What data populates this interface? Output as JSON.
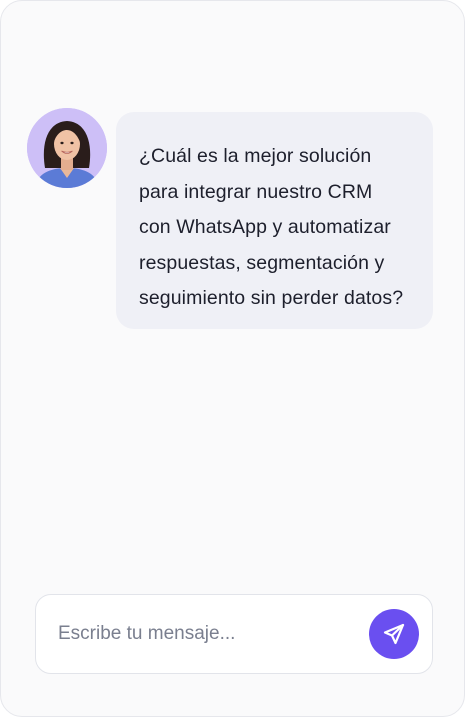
{
  "chat": {
    "message_lines": [
      "¿Cuál es la mejor solución",
      "para integrar nuestro CRM",
      "con WhatsApp y automatizar",
      "respuestas, segmentación y",
      "seguimiento sin perder datos?"
    ]
  },
  "composer": {
    "value": "",
    "placeholder": "Escribe tu mensaje...",
    "send_icon": "paper-plane-icon"
  },
  "colors": {
    "accent": "#6a4ff0",
    "bubble_background": "#eff0f6",
    "avatar_background": "#cdbff7",
    "text": "#1d1f2c",
    "placeholder": "#7a7f8f"
  }
}
